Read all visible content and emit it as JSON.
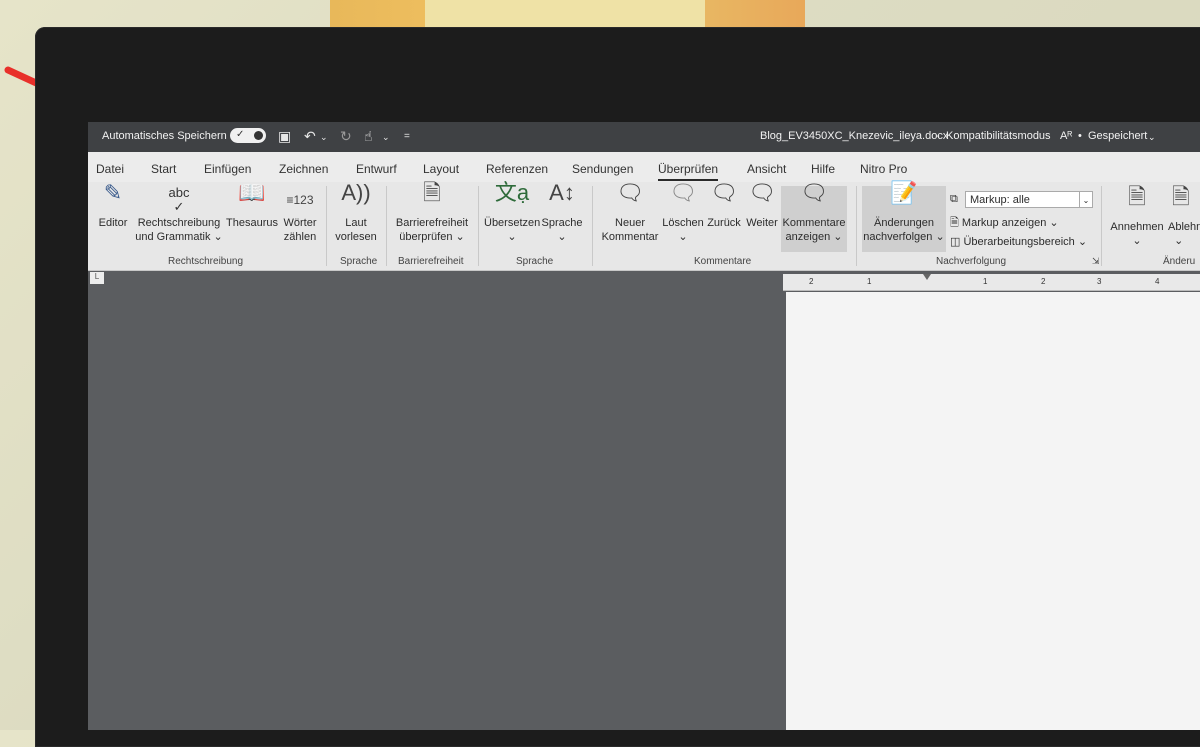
{
  "window": {
    "autosave_label": "Automatisches Speichern",
    "autosave_state": "on",
    "filename": "Blog_EV3450XC_Knezevic_ileya.docx",
    "mode": "Kompatibilitätsmodus",
    "saved_status": "Gespeichert"
  },
  "tabs": [
    {
      "label": "Datei"
    },
    {
      "label": "Start"
    },
    {
      "label": "Einfügen"
    },
    {
      "label": "Zeichnen"
    },
    {
      "label": "Entwurf"
    },
    {
      "label": "Layout"
    },
    {
      "label": "Referenzen"
    },
    {
      "label": "Sendungen"
    },
    {
      "label": "Überprüfen",
      "active": true
    },
    {
      "label": "Ansicht"
    },
    {
      "label": "Hilfe"
    },
    {
      "label": "Nitro Pro"
    }
  ],
  "ribbon": {
    "proofing": {
      "editor": "Editor",
      "spelling_l1": "Rechtschreibung",
      "spelling_l2": "und Grammatik",
      "spelling_icon_text": "abc",
      "thesaurus": "Thesaurus",
      "wordcount_l1": "Wörter",
      "wordcount_l2": "zählen",
      "wordcount_icon_text": "123",
      "group": "Rechtschreibung"
    },
    "speech": {
      "read_l1": "Laut",
      "read_l2": "vorlesen",
      "group": "Sprache"
    },
    "accessibility": {
      "check_l1": "Barrierefreiheit",
      "check_l2": "überprüfen",
      "group": "Barrierefreiheit"
    },
    "language": {
      "translate": "Übersetzen",
      "language": "Sprache",
      "group": "Sprache"
    },
    "comments": {
      "new_l1": "Neuer",
      "new_l2": "Kommentar",
      "delete": "Löschen",
      "previous": "Zurück",
      "next": "Weiter",
      "show_l1": "Kommentare",
      "show_l2": "anzeigen",
      "group": "Kommentare"
    },
    "tracking": {
      "track_l1": "Änderungen",
      "track_l2": "nachverfolgen",
      "markup_select": "Markup: alle",
      "show_markup": "Markup anzeigen",
      "reviewing_pane": "Überarbeitungsbereich",
      "group": "Nachverfolgung"
    },
    "changes": {
      "accept": "Annehmen",
      "reject": "Ablehn",
      "group": "Änderu"
    }
  },
  "ruler": {
    "labels": [
      "2",
      "1",
      "1",
      "2",
      "3",
      "4"
    ]
  },
  "colors": {
    "titlebar": "#3f4144",
    "ribbon": "#e7e7e7",
    "workspace": "#5b5d60",
    "arrow": "#e8302a"
  }
}
